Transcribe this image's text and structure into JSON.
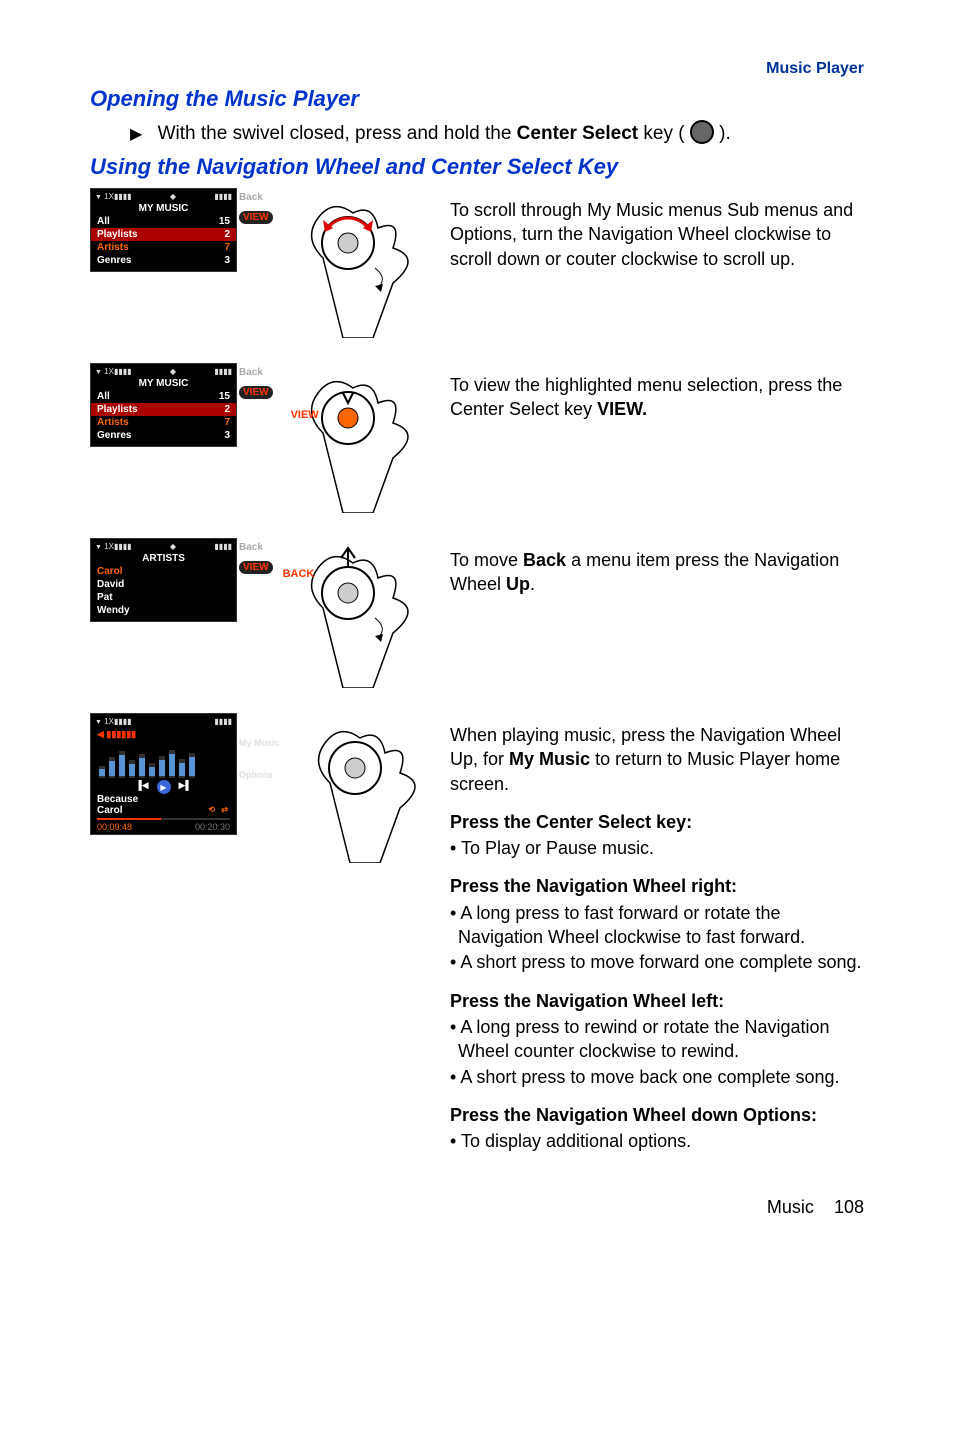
{
  "top_link": "Music Player",
  "sec1_title": "Opening the Music Player",
  "intro_text_pre": "With the swivel closed, press and hold the ",
  "intro_text_key": "Center Select",
  "intro_text_after": " key (",
  "intro_text_close": ").",
  "sec2_title": "Using the Navigation Wheel and Center Select Key",
  "signal": "1X▮▮▮▮",
  "battery": "▮▮▮▮",
  "diamond": "◆",
  "screen1": {
    "title": "MY MUSIC",
    "rows": [
      {
        "label": "All",
        "val": "15"
      },
      {
        "label": "Playlists",
        "val": "2",
        "sel": true
      },
      {
        "label": "Artists",
        "val": "7",
        "orange": true
      },
      {
        "label": "Genres",
        "val": "3"
      }
    ]
  },
  "sk_back": "Back",
  "sk_view": "VIEW",
  "screen2": {
    "title": "MY MUSIC",
    "rows": [
      {
        "label": "All",
        "val": "15"
      },
      {
        "label": "Playlists",
        "val": "2",
        "sel": true
      },
      {
        "label": "Artists",
        "val": "7",
        "orange": true
      },
      {
        "label": "Genres",
        "val": "3"
      }
    ]
  },
  "screen3": {
    "title": "ARTISTS",
    "rows": [
      {
        "label": "Carol",
        "val": "",
        "orange": true
      },
      {
        "label": "David",
        "val": ""
      },
      {
        "label": "Pat",
        "val": ""
      },
      {
        "label": "Wendy",
        "val": ""
      }
    ]
  },
  "screen4": {
    "song": "Because",
    "artist": "Carol",
    "elapsed": "00:09:48",
    "total": "00:20:30",
    "sk1": "My Music",
    "sk2": "Options"
  },
  "wheel_label2": "VIEW",
  "wheel_label3": "BACK",
  "desc1": "To scroll through My Music menus Sub menus and Options, turn the Navigation Wheel clockwise to scroll down or couter clockwise to scroll up.",
  "desc2_pre": "To view the highlighted menu selection, press the Center Select key ",
  "desc2_key": "VIEW.",
  "desc3_pre": "To move ",
  "desc3_b1": "Back",
  "desc3_mid": " a menu item press the Navigation Wheel ",
  "desc3_b2": "Up",
  "desc3_dot": ".",
  "desc4_pre": "When playing music, press the Navigation Wheel Up, for ",
  "desc4_b1": "My Music",
  "desc4_post": " to return to Music Player home screen.",
  "h4a": "Press the Center Select key:",
  "li_a1": "To Play or Pause music.",
  "h4b": "Press the Navigation Wheel right:",
  "li_b1": "A long press to fast forward or rotate the Navigation Wheel clockwise to fast forward.",
  "li_b2": "A short press to move forward one complete song.",
  "h4c": "Press the Navigation Wheel left:",
  "li_c1": "A long press to rewind or rotate the Navigation Wheel counter clockwise to rewind.",
  "li_c2": "A short press to move back one complete song.",
  "h4d": "Press the Navigation Wheel down Options:",
  "li_d1": "To display additional options.",
  "footer_label": "Music",
  "footer_page": "108"
}
